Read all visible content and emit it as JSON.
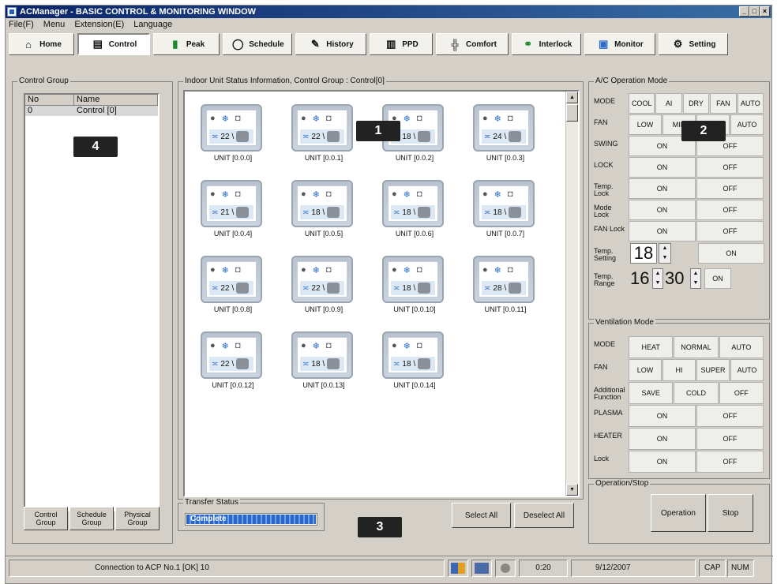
{
  "window": {
    "title": "ACManager - BASIC CONTROL & MONITORING WINDOW",
    "controls": [
      "_",
      "□",
      "×"
    ]
  },
  "menu": [
    "File(F)",
    "Menu",
    "Extension(E)",
    "Language"
  ],
  "toolbar": [
    {
      "label": "Home",
      "icon": "home-icon"
    },
    {
      "label": "Control",
      "icon": "control-icon"
    },
    {
      "label": "Peak",
      "icon": "peak-icon"
    },
    {
      "label": "Schedule",
      "icon": "schedule-icon"
    },
    {
      "label": "History",
      "icon": "history-icon"
    },
    {
      "label": "PPD",
      "icon": "ppd-icon"
    },
    {
      "label": "Comfort",
      "icon": "comfort-icon"
    },
    {
      "label": "Interlock",
      "icon": "interlock-icon"
    },
    {
      "label": "Monitor",
      "icon": "monitor-icon"
    },
    {
      "label": "Setting",
      "icon": "setting-icon"
    }
  ],
  "control_group": {
    "title": "Control Group",
    "columns": [
      "No",
      "Name"
    ],
    "rows": [
      {
        "no": "0",
        "name": "Control [0]"
      }
    ],
    "buttons": [
      "Control Group",
      "Schedule Group",
      "Physical Group"
    ]
  },
  "units_panel": {
    "title": "Indoor Unit Status Information, Control Group : Control[0]",
    "units": [
      {
        "temp": "22",
        "label": "UNIT [0.0.0]"
      },
      {
        "temp": "22",
        "label": "UNIT [0.0.1]"
      },
      {
        "temp": "18",
        "label": "UNIT [0.0.2]"
      },
      {
        "temp": "24",
        "label": "UNIT [0.0.3]"
      },
      {
        "temp": "21",
        "label": "UNIT [0.0.4]"
      },
      {
        "temp": "18",
        "label": "UNIT [0.0.5]"
      },
      {
        "temp": "18",
        "label": "UNIT [0.0.6]"
      },
      {
        "temp": "18",
        "label": "UNIT [0.0.7]"
      },
      {
        "temp": "22",
        "label": "UNIT [0.0.8]"
      },
      {
        "temp": "22",
        "label": "UNIT [0.0.9]"
      },
      {
        "temp": "18",
        "label": "UNIT [0.0.10]"
      },
      {
        "temp": "28",
        "label": "UNIT [0.0.11]"
      },
      {
        "temp": "22",
        "label": "UNIT [0.0.12]"
      },
      {
        "temp": "18",
        "label": "UNIT [0.0.13]"
      },
      {
        "temp": "18",
        "label": "UNIT [0.0.14]"
      }
    ]
  },
  "transfer": {
    "title": "Transfer Status",
    "status": "Complete",
    "progress": 1.0
  },
  "bottom_buttons": {
    "select_all": "Select All",
    "deselect": "Deselect All"
  },
  "ac_mode": {
    "title": "A/C Operation Mode",
    "rows": [
      {
        "label": "MODE",
        "options": [
          "COOL",
          "AI",
          "DRY",
          "FAN",
          "AUTO"
        ]
      },
      {
        "label": "FAN",
        "options": [
          "LOW",
          "MID",
          "HIGH",
          "AUTO"
        ]
      },
      {
        "label": "SWING",
        "options": [
          "ON",
          "OFF"
        ]
      },
      {
        "label": "LOCK",
        "options": [
          "ON",
          "OFF"
        ]
      },
      {
        "label": "Temp. Lock",
        "options": [
          "ON",
          "OFF"
        ]
      },
      {
        "label": "Mode Lock",
        "options": [
          "ON",
          "OFF"
        ]
      },
      {
        "label": "FAN Lock",
        "options": [
          "ON",
          "OFF"
        ]
      }
    ],
    "temp_setting": {
      "label": "Temp. Setting",
      "value": "18",
      "button": "ON"
    },
    "temp_range": {
      "label": "Temp. Range",
      "min": "16",
      "max": "30",
      "button": "ON"
    }
  },
  "ventilation": {
    "title": "Ventilation Mode",
    "rows": [
      {
        "label": "MODE",
        "options": [
          "HEAT",
          "NORMAL",
          "AUTO"
        ]
      },
      {
        "label": "FAN",
        "options": [
          "LOW",
          "HI",
          "SUPER",
          "AUTO"
        ]
      },
      {
        "label": "Additional Function",
        "options": [
          "SAVE",
          "COLD",
          "OFF"
        ]
      },
      {
        "label": "PLASMA",
        "options": [
          "ON",
          "OFF"
        ]
      },
      {
        "label": "HEATER",
        "options": [
          "ON",
          "OFF"
        ]
      },
      {
        "label": "Lock",
        "options": [
          "ON",
          "OFF"
        ]
      }
    ]
  },
  "operation": {
    "title": "Operation/Stop",
    "operation": "Operation",
    "stop": "Stop"
  },
  "statusbar": {
    "connection": "Connection to ACP No.1 [OK] 10",
    "time": "0:20",
    "date": "9/12/2007",
    "cap": "CAP",
    "num": "NUM"
  },
  "badges": [
    "1",
    "2",
    "3",
    "4"
  ]
}
